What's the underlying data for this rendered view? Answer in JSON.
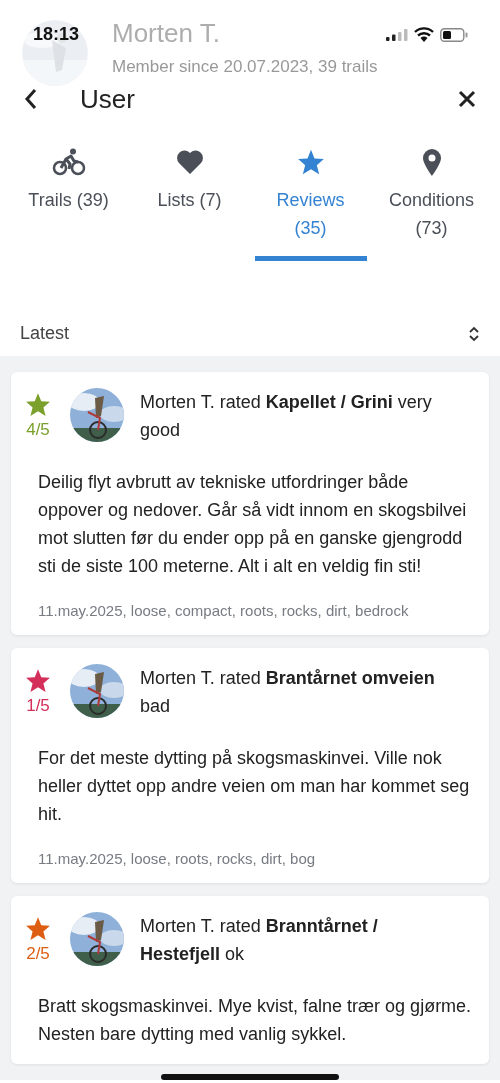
{
  "status_bar": {
    "time": "18:13"
  },
  "profile": {
    "name": "Morten T.",
    "subtitle": "Member since 20.07.2023, 39 trails"
  },
  "nav": {
    "title": "User"
  },
  "tabs": [
    {
      "label": "Trails (39)",
      "selected": false
    },
    {
      "label": "Lists (7)",
      "selected": false
    },
    {
      "label": "Reviews (35)",
      "selected": true
    },
    {
      "label": "Conditions (73)",
      "selected": false
    }
  ],
  "sort": {
    "label": "Latest"
  },
  "reviews": [
    {
      "rating": "4/5",
      "color": "#7ba02c",
      "title": "Morten T. rated **Kapellet / Grini** very good",
      "text": "Deilig flyt avbrutt av tekniske utfordringer både oppover og nedover. Går så vidt innom en skogsbilvei mot slutten før du ender opp på en ganske gjengrodd sti de siste 100 meterne. Alt i alt en veldig fin sti!",
      "meta": "11.may.2025, loose, compact, roots, rocks, dirt, bedrock"
    },
    {
      "rating": "1/5",
      "color": "#d42f5a",
      "title": "Morten T. rated **Brantårnet omveien** bad",
      "text": "For det meste dytting på skogsmaskinvei. Ville nok heller dyttet opp andre veien om man har kommet seg hit.",
      "meta": "11.may.2025, loose, roots, rocks, dirt, bog"
    },
    {
      "rating": "2/5",
      "color": "#dd5e12",
      "title": "Morten T. rated **Branntårnet / Hestefjell** ok",
      "text": "Bratt skogsmaskinvei. Mye kvist, falne trær og gjørme. Nesten bare dytting med vanlig sykkel."
    }
  ]
}
